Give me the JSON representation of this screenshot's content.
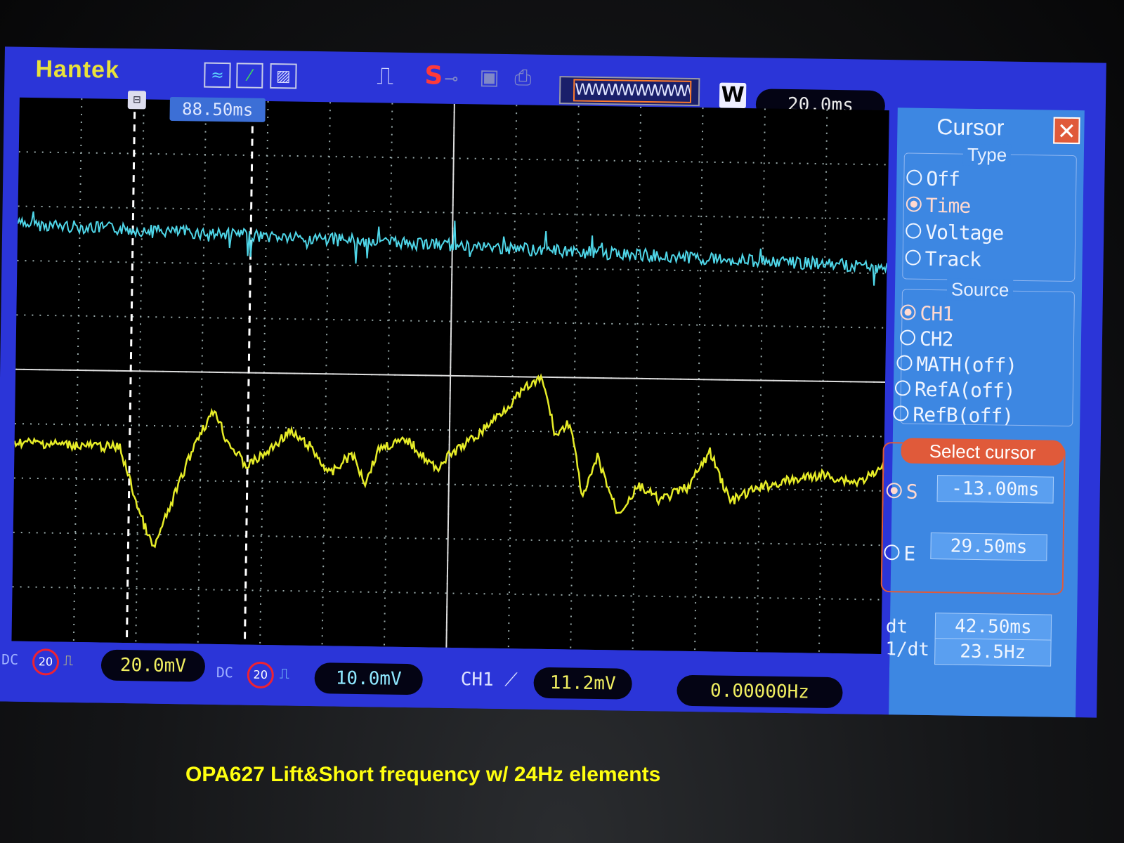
{
  "brand": "Hantek",
  "topbar": {
    "run_stop": "S",
    "overview_wave": "WWWWWWWWW",
    "window_btn": "W",
    "timebase": "20.0ms"
  },
  "cursor_flag": "88.50ms",
  "side_menu": {
    "title": "Cursor",
    "close": "✕",
    "type_label": "Type",
    "type_options": [
      {
        "label": "Off",
        "selected": false
      },
      {
        "label": "Time",
        "selected": true
      },
      {
        "label": "Voltage",
        "selected": false
      },
      {
        "label": "Track",
        "selected": false
      }
    ],
    "source_label": "Source",
    "source_options": [
      {
        "label": "CH1",
        "selected": true
      },
      {
        "label": "CH2",
        "selected": false
      },
      {
        "label": "MATH(off)",
        "selected": false
      },
      {
        "label": "RefA(off)",
        "selected": false
      },
      {
        "label": "RefB(off)",
        "selected": false
      }
    ],
    "select_cursor_label": "Select cursor",
    "s_label": "S",
    "s_value": "-13.00ms",
    "e_label": "E",
    "e_value": "29.50ms",
    "dt_label": "dt",
    "dt_value": "42.50ms",
    "inv_dt_label": "1/dt",
    "inv_dt_value": "23.5Hz"
  },
  "bottom_bar": {
    "ch1_coupling": "DC",
    "ch1_bw": "20",
    "ch1_scale": "20.0mV",
    "ch2_coupling": "DC",
    "ch2_bw": "20",
    "ch2_scale": "10.0mV",
    "trigger_source": "CH1",
    "trigger_level": "11.2mV",
    "frequency": "0.00000Hz"
  },
  "caption": "OPA627 Lift&Short frequency w/ 24Hz elements",
  "colors": {
    "ch1_trace": "#e6ec28",
    "ch2_trace": "#4fd6e8",
    "screen_bg": "#2b35d8",
    "menu_bg": "#3d87e2",
    "accent": "#e05a3a"
  }
}
